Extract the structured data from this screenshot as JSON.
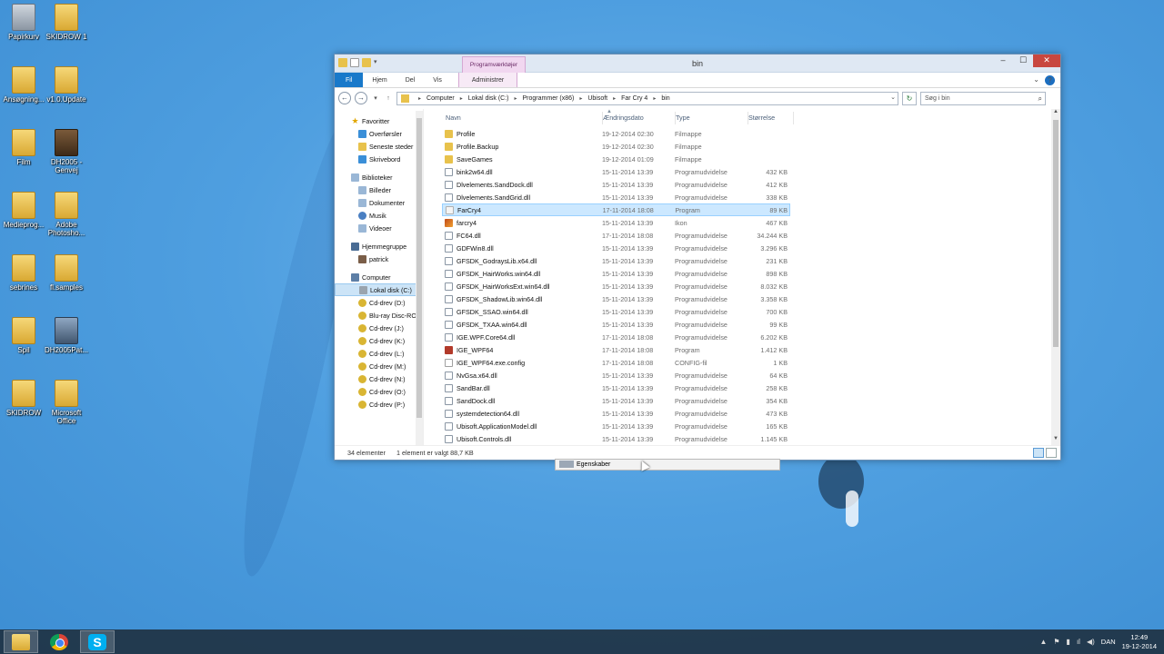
{
  "desktop": {
    "icons": [
      {
        "label": "Papirkurv"
      },
      {
        "label": "SKIDROW 1"
      },
      {
        "label": "Ansøgning..."
      },
      {
        "label": "v1.0.Update"
      },
      {
        "label": "Film"
      },
      {
        "label": "DH2005 - Genvej"
      },
      {
        "label": "Medieprog..."
      },
      {
        "label": "Adobe Photosho..."
      },
      {
        "label": "sebrines"
      },
      {
        "label": "fl.samples"
      },
      {
        "label": "Spil"
      },
      {
        "label": "DH2005Pat..."
      },
      {
        "label": "SKIDROW"
      },
      {
        "label": "Microsoft Office"
      }
    ]
  },
  "window": {
    "title": "bin",
    "context_tab_group": "Programværktøjer",
    "ribbon_tabs": [
      "Fil",
      "Hjem",
      "Del",
      "Vis",
      "Administrer"
    ],
    "address": {
      "crumbs": [
        "Computer",
        "Lokal disk (C:)",
        "Programmer (x86)",
        "Ubisoft",
        "Far Cry 4",
        "bin"
      ]
    },
    "search_placeholder": "Søg i bin",
    "nav": {
      "favorites_header": "Favoritter",
      "favorites": [
        "Overførsler",
        "Seneste steder",
        "Skrivebord"
      ],
      "libraries_header": "Biblioteker",
      "libraries": [
        "Billeder",
        "Dokumenter",
        "Musik",
        "Videoer"
      ],
      "homegroup_header": "Hjemmegruppe",
      "homegroup": [
        "patrick"
      ],
      "computer_header": "Computer",
      "drives": [
        "Lokal disk (C:)",
        "Cd-drev (D:)",
        "Blu-ray Disc-ROM",
        "Cd-drev (J:)",
        "Cd-drev (K:)",
        "Cd-drev (L:)",
        "Cd-drev (M:)",
        "Cd-drev (N:)",
        "Cd-drev (O:)",
        "Cd-drev (P:)"
      ]
    },
    "columns": {
      "name": "Navn",
      "date": "Ændringsdato",
      "type": "Type",
      "size": "Størrelse"
    },
    "files": [
      {
        "name": "Profile",
        "date": "19-12-2014 02:30",
        "type": "Filmappe",
        "size": "",
        "icon": "folder"
      },
      {
        "name": "Profile.Backup",
        "date": "19-12-2014 02:30",
        "type": "Filmappe",
        "size": "",
        "icon": "folder"
      },
      {
        "name": "SaveGames",
        "date": "19-12-2014 01:09",
        "type": "Filmappe",
        "size": "",
        "icon": "folder"
      },
      {
        "name": "bink2w64.dll",
        "date": "15-11-2014 13:39",
        "type": "Programudvidelse",
        "size": "432 KB",
        "icon": "dll"
      },
      {
        "name": "Dlvelements.SandDock.dll",
        "date": "15-11-2014 13:39",
        "type": "Programudvidelse",
        "size": "412 KB",
        "icon": "dll"
      },
      {
        "name": "Dlvelements.SandGrid.dll",
        "date": "15-11-2014 13:39",
        "type": "Programudvidelse",
        "size": "338 KB",
        "icon": "dll"
      },
      {
        "name": "FarCry4",
        "date": "17-11-2014 18:08",
        "type": "Program",
        "size": "89 KB",
        "icon": "exe",
        "selected": true
      },
      {
        "name": "farcry4",
        "date": "15-11-2014 13:39",
        "type": "Ikon",
        "size": "467 KB",
        "icon": "ico"
      },
      {
        "name": "FC64.dll",
        "date": "17-11-2014 18:08",
        "type": "Programudvidelse",
        "size": "34.244 KB",
        "icon": "dll"
      },
      {
        "name": "GDFWin8.dll",
        "date": "15-11-2014 13:39",
        "type": "Programudvidelse",
        "size": "3.296 KB",
        "icon": "dll"
      },
      {
        "name": "GFSDK_GodraysLib.x64.dll",
        "date": "15-11-2014 13:39",
        "type": "Programudvidelse",
        "size": "231 KB",
        "icon": "dll"
      },
      {
        "name": "GFSDK_HairWorks.win64.dll",
        "date": "15-11-2014 13:39",
        "type": "Programudvidelse",
        "size": "898 KB",
        "icon": "dll"
      },
      {
        "name": "GFSDK_HairWorksExt.win64.dll",
        "date": "15-11-2014 13:39",
        "type": "Programudvidelse",
        "size": "8.032 KB",
        "icon": "dll"
      },
      {
        "name": "GFSDK_ShadowLib.win64.dll",
        "date": "15-11-2014 13:39",
        "type": "Programudvidelse",
        "size": "3.358 KB",
        "icon": "dll"
      },
      {
        "name": "GFSDK_SSAO.win64.dll",
        "date": "15-11-2014 13:39",
        "type": "Programudvidelse",
        "size": "700 KB",
        "icon": "dll"
      },
      {
        "name": "GFSDK_TXAA.win64.dll",
        "date": "15-11-2014 13:39",
        "type": "Programudvidelse",
        "size": "99 KB",
        "icon": "dll"
      },
      {
        "name": "IGE.WPF.Core64.dll",
        "date": "17-11-2014 18:08",
        "type": "Programudvidelse",
        "size": "6.202 KB",
        "icon": "dll"
      },
      {
        "name": "IGE_WPF64",
        "date": "17-11-2014 18:08",
        "type": "Program",
        "size": "1.412 KB",
        "icon": "prog"
      },
      {
        "name": "IGE_WPF64.exe.config",
        "date": "17-11-2014 18:08",
        "type": "CONFIG-fil",
        "size": "1 KB",
        "icon": "cfg"
      },
      {
        "name": "NvGsa.x64.dll",
        "date": "15-11-2014 13:39",
        "type": "Programudvidelse",
        "size": "64 KB",
        "icon": "dll"
      },
      {
        "name": "SandBar.dll",
        "date": "15-11-2014 13:39",
        "type": "Programudvidelse",
        "size": "258 KB",
        "icon": "dll"
      },
      {
        "name": "SandDock.dll",
        "date": "15-11-2014 13:39",
        "type": "Programudvidelse",
        "size": "354 KB",
        "icon": "dll"
      },
      {
        "name": "systemdetection64.dll",
        "date": "15-11-2014 13:39",
        "type": "Programudvidelse",
        "size": "473 KB",
        "icon": "dll"
      },
      {
        "name": "Ubisoft.ApplicationModel.dll",
        "date": "15-11-2014 13:39",
        "type": "Programudvidelse",
        "size": "165 KB",
        "icon": "dll"
      },
      {
        "name": "Ubisoft.Controls.dll",
        "date": "15-11-2014 13:39",
        "type": "Programudvidelse",
        "size": "1.145 KB",
        "icon": "dll"
      }
    ],
    "status": {
      "count": "34 elementer",
      "selection": "1 element er valgt  88,7 KB"
    }
  },
  "popup": {
    "label": "Egenskaber"
  },
  "taskbar": {
    "language": "DAN",
    "time": "12:49",
    "date": "19-12-2014",
    "skype_letter": "S"
  },
  "colors": {
    "accent": "#1979ca",
    "selection": "#cce8ff",
    "close": "#c8473f"
  }
}
